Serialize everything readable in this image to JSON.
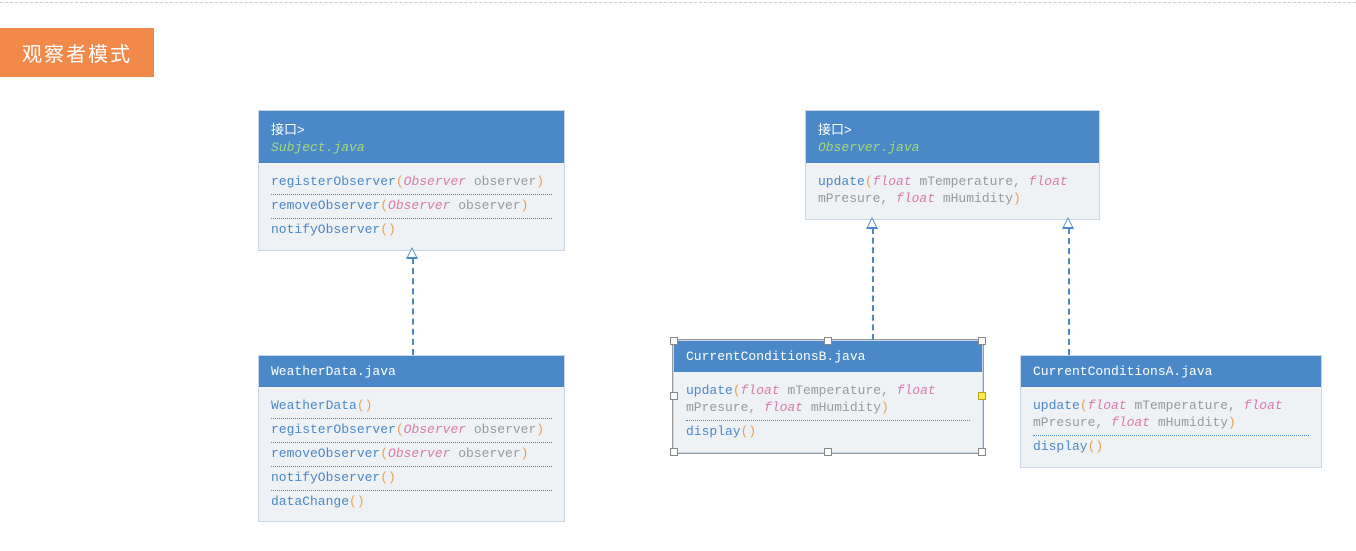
{
  "title": "观察者模式",
  "subject": {
    "stereotype": "接口>",
    "name": "Subject.java",
    "methods": {
      "m1_name": "registerObserver",
      "m1_t": "Observer",
      "m1_p": " observer",
      "m2_name": "removeObserver",
      "m2_t": "Observer",
      "m2_p": " observer",
      "m3_name": "notifyObserver"
    }
  },
  "observer": {
    "stereotype": "接口>",
    "name": "Observer.java",
    "methods": {
      "m1_name": "update",
      "m1_t1": "float",
      "m1_p1": " mTemperature, ",
      "m1_t2": "float",
      "m1_p2": " mPresure, ",
      "m1_t3": "float",
      "m1_p3": " mHumidity"
    }
  },
  "weatherData": {
    "name": "WeatherData.java",
    "methods": {
      "m1_name": "WeatherData",
      "m2_name": "registerObserver",
      "m2_t": "Observer",
      "m2_p": " observer",
      "m3_name": "removeObserver",
      "m3_t": "Observer",
      "m3_p": " observer",
      "m4_name": "notifyObserver",
      "m5_name": "dataChange"
    }
  },
  "condB": {
    "name": "CurrentConditionsB.java",
    "methods": {
      "m1_name": "update",
      "m1_t1": "float",
      "m1_p1": " mTemperature, ",
      "m1_t2": "float",
      "m1_p2": " mPresure, ",
      "m1_t3": "float",
      "m1_p3": " mHumidity",
      "m2_name": "display"
    }
  },
  "condA": {
    "name": "CurrentConditionsA.java",
    "methods": {
      "m1_name": "update",
      "m1_t1": "float",
      "m1_p1": " mTemperature, ",
      "m1_t2": "float",
      "m1_p2": " mPresure, ",
      "m1_t3": "float",
      "m1_p3": " mHumidity",
      "m2_name": "display"
    }
  }
}
